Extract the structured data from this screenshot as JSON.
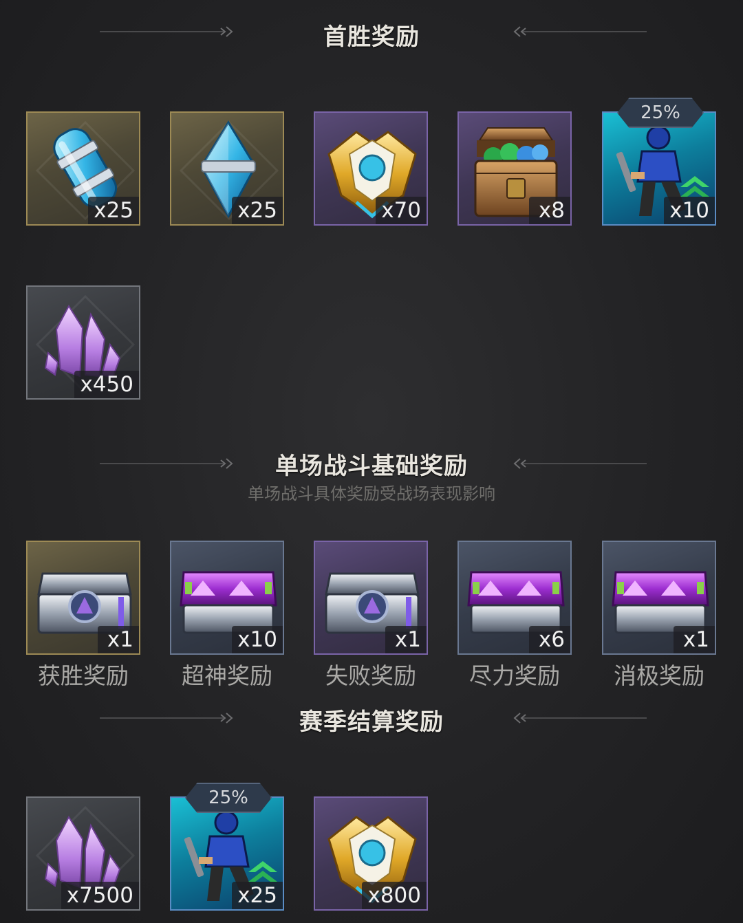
{
  "sections": {
    "first_win": {
      "title": "首胜奖励"
    },
    "basic": {
      "title": "单场战斗基础奖励",
      "subtitle": "单场战斗具体奖励受战场表现影响"
    },
    "season": {
      "title": "赛季结算奖励"
    }
  },
  "first_win_items": [
    {
      "name": "blue-capsule",
      "qty": "x25"
    },
    {
      "name": "blue-crystal",
      "qty": "x25"
    },
    {
      "name": "gold-emblem",
      "qty": "x70"
    },
    {
      "name": "treasure-chest",
      "qty": "x8"
    },
    {
      "name": "soldier-card",
      "qty": "x10",
      "badge": "25%"
    },
    {
      "name": "purple-crystal",
      "qty": "x450"
    }
  ],
  "basic_items": [
    {
      "name": "silver-chest",
      "qty": "x1",
      "caption": "获胜奖励"
    },
    {
      "name": "purple-chest",
      "qty": "x10",
      "caption": "超神奖励"
    },
    {
      "name": "silver-chest",
      "qty": "x1",
      "caption": "失败奖励"
    },
    {
      "name": "purple-chest",
      "qty": "x6",
      "caption": "尽力奖励"
    },
    {
      "name": "purple-chest",
      "qty": "x1",
      "caption": "消极奖励"
    }
  ],
  "season_items": [
    {
      "name": "purple-crystal",
      "qty": "x7500"
    },
    {
      "name": "soldier-card",
      "qty": "x25",
      "badge": "25%"
    },
    {
      "name": "gold-emblem",
      "qty": "x800"
    }
  ],
  "colors": {
    "background": "#232325",
    "title": "#e9e6df",
    "subtitle": "#6f6e6b",
    "caption": "#aaa9a6"
  }
}
